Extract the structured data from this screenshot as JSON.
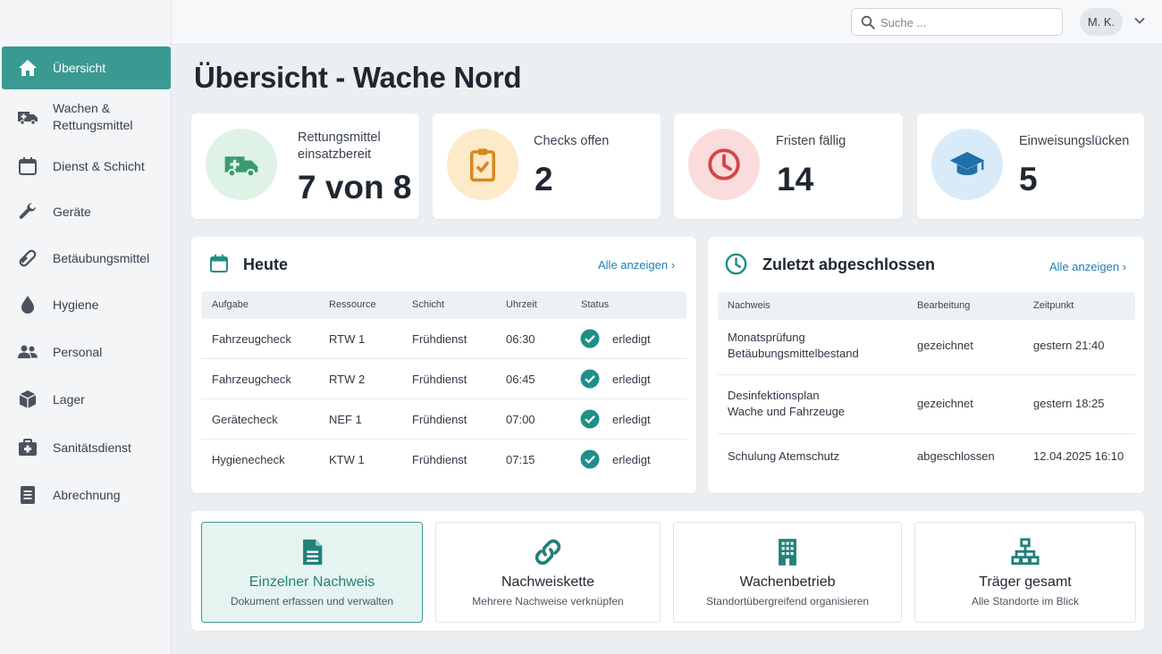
{
  "sidebar": {
    "items": [
      {
        "label": "Übersicht",
        "icon": "home-icon"
      },
      {
        "label": "Wachen & Rettungsmittel",
        "icon": "ambulance-icon"
      },
      {
        "label": "Dienst & Schicht",
        "icon": "calendar-icon"
      },
      {
        "label": "Geräte",
        "icon": "wrench-icon"
      },
      {
        "label": "Betäubungsmittel",
        "icon": "pill-icon"
      },
      {
        "label": "Hygiene",
        "icon": "drop-icon"
      },
      {
        "label": "Personal",
        "icon": "people-icon"
      },
      {
        "label": "Lager",
        "icon": "box-icon"
      },
      {
        "label": "Sanitätsdienst",
        "icon": "medical-kit-icon"
      },
      {
        "label": "Abrechnung",
        "icon": "document-icon"
      }
    ]
  },
  "topbar": {
    "search_placeholder": "Suche ...",
    "user_initials": "M. K."
  },
  "page_title": "Übersicht - Wache Nord",
  "kpis": [
    {
      "label": "Rettungsmittel einsatzbereit",
      "value": "7 von 8",
      "color": "#3a9a6e",
      "bg": "#dff2e6"
    },
    {
      "label": "Checks offen",
      "value": "2",
      "color": "#d8871f",
      "bg": "#fdeac9"
    },
    {
      "label": "Fristen fällig",
      "value": "14",
      "color": "#d64545",
      "bg": "#fadcdc"
    },
    {
      "label": "Einweisungslücken",
      "value": "5",
      "color": "#1f6fa8",
      "bg": "#d9ebf8"
    }
  ],
  "today": {
    "title": "Heute",
    "link": "Alle anzeigen",
    "columns": [
      "Aufgabe",
      "Ressource",
      "Schicht",
      "Uhrzeit",
      "Status"
    ],
    "rows": [
      {
        "task": "Fahrzeugcheck",
        "resource": "RTW 1",
        "shift": "Frühdienst",
        "time": "06:30",
        "status": "erledigt"
      },
      {
        "task": "Fahrzeugcheck",
        "resource": "RTW 2",
        "shift": "Frühdienst",
        "time": "06:45",
        "status": "erledigt"
      },
      {
        "task": "Gerätecheck",
        "resource": "NEF 1",
        "shift": "Frühdienst",
        "time": "07:00",
        "status": "erledigt"
      },
      {
        "task": "Hygienecheck",
        "resource": "KTW 1",
        "shift": "Frühdienst",
        "time": "07:15",
        "status": "erledigt"
      }
    ]
  },
  "recent": {
    "title": "Zuletzt abgeschlossen",
    "link": "Alle anzeigen",
    "columns": [
      "Nachweis",
      "Bearbeitung",
      "Zeitpunkt"
    ],
    "rows": [
      {
        "proof_line1": "Monatsprüfung",
        "proof_line2": "Betäubungsmittelbestand",
        "processing": "gezeichnet",
        "time": "gestern 21:40"
      },
      {
        "proof_line1": "Desinfektionsplan",
        "proof_line2": "Wache und Fahrzeuge",
        "processing": "gezeichnet",
        "time": "gestern 18:25"
      },
      {
        "proof_line1": "Schulung Atemschutz",
        "proof_line2": "",
        "processing": "abgeschlossen",
        "time": "12.04.2025 16:10"
      }
    ]
  },
  "actions": [
    {
      "title": "Einzelner Nachweis",
      "subtitle": "Dokument erfassen und verwalten",
      "icon": "document-icon"
    },
    {
      "title": "Nachweiskette",
      "subtitle": "Mehrere Nachweise verknüpfen",
      "icon": "link-icon"
    },
    {
      "title": "Wachenbetrieb",
      "subtitle": "Standortübergreifend organisieren",
      "icon": "building-icon"
    },
    {
      "title": "Träger gesamt",
      "subtitle": "Alle Standorte im Blick",
      "icon": "hierarchy-icon"
    }
  ],
  "colors": {
    "accent": "#3a9a92",
    "link": "#1a7fb8",
    "success": "#1f8f87"
  }
}
